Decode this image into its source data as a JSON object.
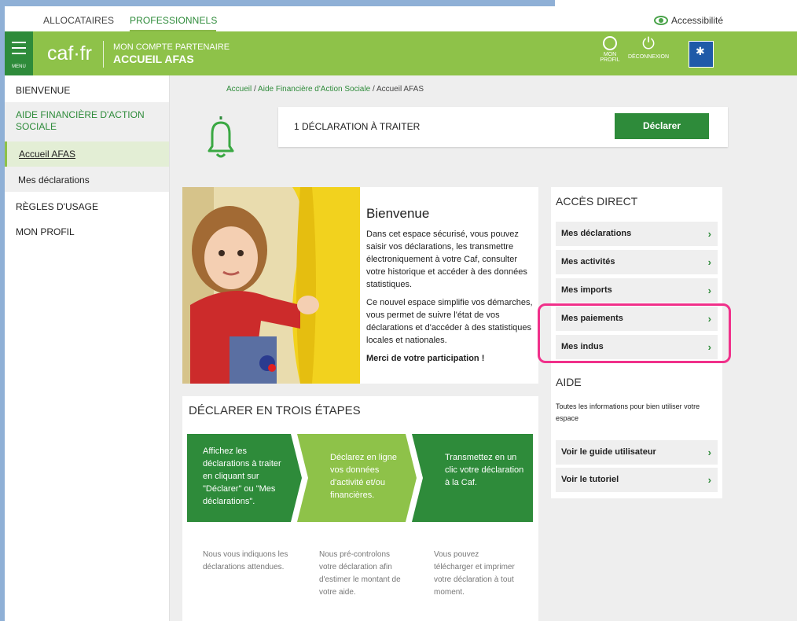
{
  "topbar": {
    "allocataires": "ALLOCATAIRES",
    "professionnels": "PROFESSIONNELS",
    "accessibilite": "Accessibilité"
  },
  "header": {
    "menu_label": "MENU",
    "logo": "caf·fr",
    "compte": "MON COMPTE PARTENAIRE",
    "page": "ACCUEIL AFAS",
    "profil": "MON PROFIL",
    "deconnexion": "DÉCONNEXION"
  },
  "sidebar": {
    "bienvenue": "BIENVENUE",
    "afas_group": "AIDE FINANCIÈRE D'ACTION SOCIALE",
    "accueil": "Accueil AFAS",
    "mes_declarations": "Mes déclarations",
    "regles": "RÈGLES D'USAGE",
    "profil": "MON PROFIL"
  },
  "breadcrumb": {
    "accueil": "Accueil",
    "afas": "Aide Financière d'Action Sociale",
    "current": "Accueil AFAS"
  },
  "declaration": {
    "text": "1 DÉCLARATION À TRAITER",
    "button": "Déclarer"
  },
  "welcome": {
    "title": "Bienvenue",
    "p1": "Dans cet espace sécurisé, vous pouvez saisir vos déclarations, les transmettre électroniquement à votre Caf, consulter votre historique et accéder à des données statistiques.",
    "p2": "Ce nouvel espace simplifie vos démarches, vous permet de suivre l'état de vos déclarations et d'accéder à des statistiques locales et nationales.",
    "p3": "Merci de votre participation !"
  },
  "steps": {
    "title": "DÉCLARER EN TROIS ÉTAPES",
    "items": [
      {
        "label": "Affichez les déclarations à traiter en cliquant sur \"Déclarer\" ou \"Mes déclarations\".",
        "desc": "Nous vous indiquons les déclarations attendues.",
        "color": "#2e8b3a"
      },
      {
        "label": "Déclarez en ligne vos données d'activité et/ou financières.",
        "desc": "Nous pré-controlons votre déclaration afin d'estimer le montant de votre aide.",
        "color": "#8ec249"
      },
      {
        "label": "Transmettez en un clic votre déclaration à la Caf.",
        "desc": "Vous pouvez télécharger et imprimer votre déclaration à tout moment.",
        "color": "#2e8b3a"
      }
    ]
  },
  "acces": {
    "title": "ACCÈS DIRECT",
    "items": [
      "Mes déclarations",
      "Mes activités",
      "Mes imports",
      "Mes paiements",
      "Mes indus"
    ]
  },
  "aide": {
    "title": "AIDE",
    "text": "Toutes les informations pour bien utiliser votre espace",
    "items": [
      "Voir le guide utilisateur",
      "Voir le tutoriel"
    ]
  },
  "colors": {
    "brand_green": "#8ec249",
    "dark_green": "#2e8b3a",
    "highlight": "#f0308a"
  }
}
